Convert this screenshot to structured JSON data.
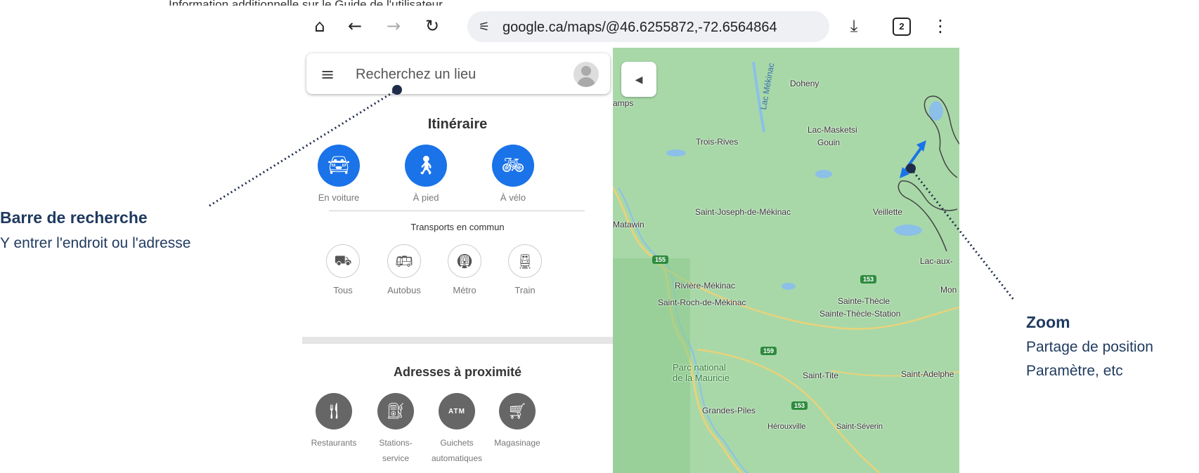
{
  "top_caption": {
    "text": "Information additionnelle sur le",
    "link": "Guide de l'utilisateur"
  },
  "browser": {
    "url": "google.ca/maps/@46.6255872,-72.6564864",
    "tab_count": "2"
  },
  "panel": {
    "search_placeholder": "Recherchez un lieu",
    "itinerary_title": "Itinéraire",
    "modes": [
      {
        "label": "En voiture",
        "icon": "car-icon"
      },
      {
        "label": "À pied",
        "icon": "walk-icon"
      },
      {
        "label": "À vélo",
        "icon": "bike-icon"
      }
    ],
    "transit_title": "Transports en commun",
    "transit": [
      {
        "label": "Tous",
        "icon": "transit-all-icon"
      },
      {
        "label": "Autobus",
        "icon": "bus-icon"
      },
      {
        "label": "Métro",
        "icon": "metro-icon"
      },
      {
        "label": "Train",
        "icon": "train-icon"
      }
    ],
    "nearby_title": "Adresses à proximité",
    "nearby": [
      {
        "label": "Restaurants",
        "icon": "restaurant-icon"
      },
      {
        "label": "Stations-service",
        "label_line1": "Stations-",
        "label_line2": "service",
        "icon": "gas-station-icon"
      },
      {
        "label": "Guichets automatiques",
        "label_line1": "Guichets",
        "label_line2": "automatiques",
        "icon": "atm-icon",
        "icon_text": "ATM"
      },
      {
        "label": "Magasinage",
        "icon": "shopping-cart-icon"
      }
    ]
  },
  "map": {
    "lake_label": "Lac Mékinac",
    "places": {
      "doheny": "Doheny",
      "camps": "amps",
      "lac_masketsi": "Lac-Masketsi",
      "gouin": "Gouin",
      "trois_rives": "Trois-Rives",
      "saint_joseph": "Saint-Joseph-de-Mékinac",
      "veillette": "Veillette",
      "matawin": "Matawin",
      "lac_aux": "Lac-aux-",
      "riviere_mekinac": "Rivière-Mékinac",
      "saint_roch": "Saint-Roch-de-Mékinac",
      "sainte_thecle": "Sainte-Thècle",
      "sainte_thecle_station": "Sainte-Thècle-Station",
      "mon": "Mon",
      "parc_line1": "Parc national",
      "parc_line2": "de la Mauricie",
      "saint_tite": "Saint-Tite",
      "saint_adelphe": "Saint-Adelphe",
      "grandes_piles": "Grandes-Piles",
      "herouxville": "Hérouxville",
      "saint_severin": "Saint-Séverin"
    },
    "shields": {
      "r155": "155",
      "r153a": "153",
      "r159": "159",
      "r153b": "153"
    }
  },
  "annotations": {
    "search": {
      "title": "Barre de recherche",
      "desc": "Y entrer l'endroit ou l'adresse"
    },
    "zoom": {
      "title": "Zoom",
      "line1": "Partage de position",
      "line2": "Paramètre, etc"
    }
  },
  "colors": {
    "blue": "#1a73e8",
    "annotation": "#1f3a5f",
    "map_green": "#a8d8a8"
  }
}
